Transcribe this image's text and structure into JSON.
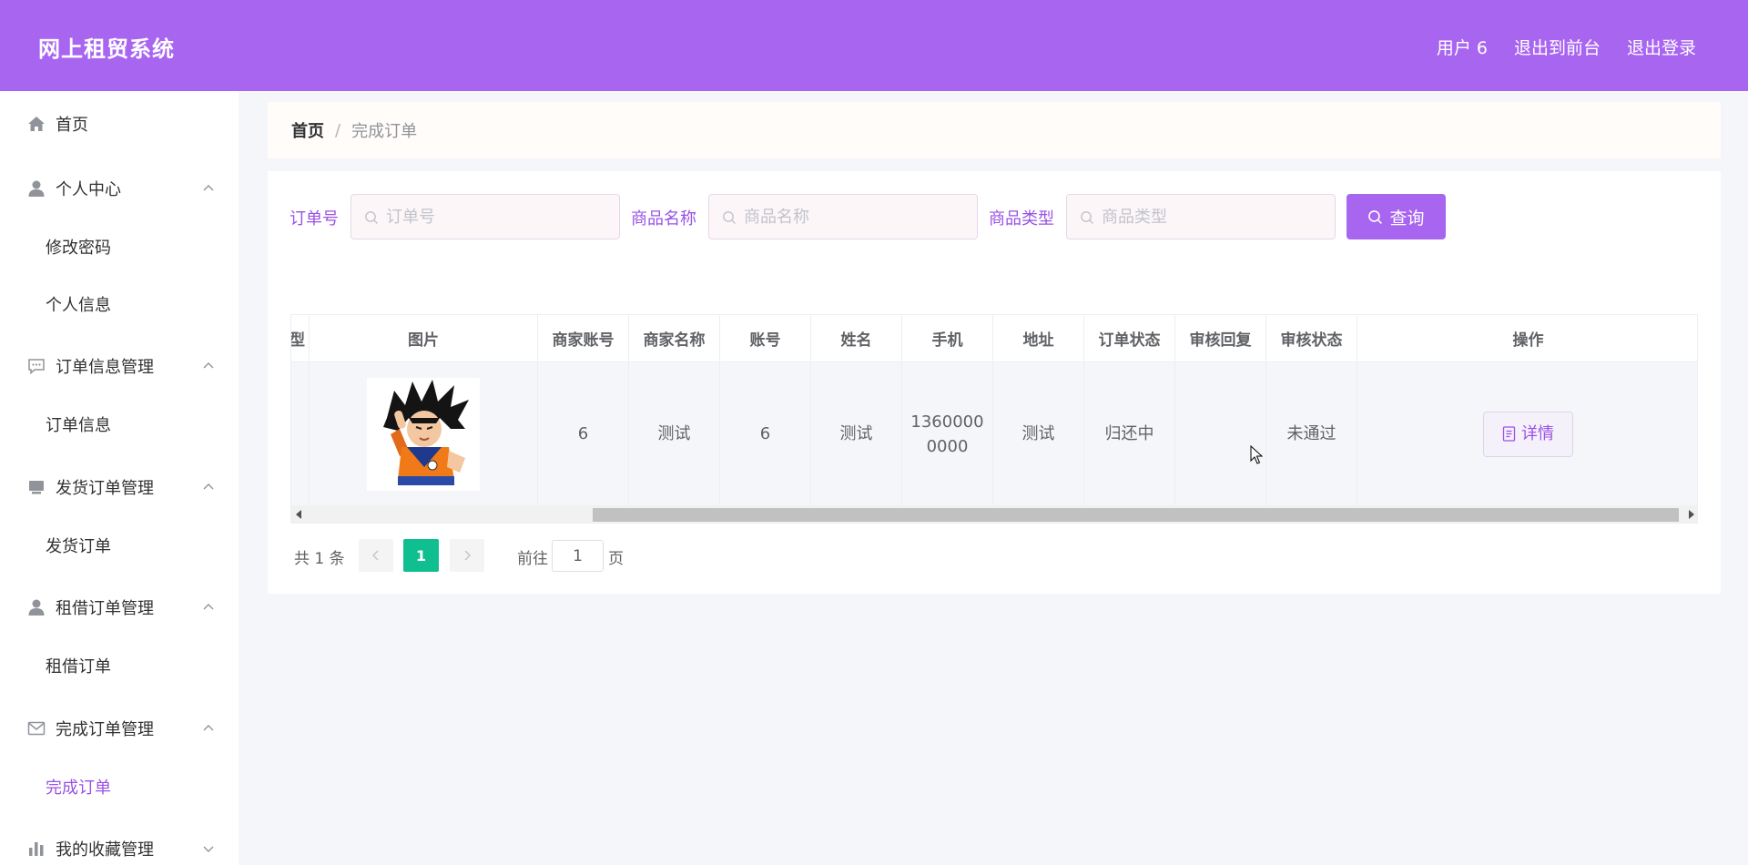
{
  "header": {
    "title": "网上租贸系统",
    "user": "用户 6",
    "exit_front": "退出到前台",
    "logout": "退出登录"
  },
  "sidebar": {
    "items": [
      {
        "label": "首页",
        "icon": "home-icon"
      },
      {
        "label": "个人中心",
        "icon": "user-icon",
        "children": [
          "修改密码",
          "个人信息"
        ]
      },
      {
        "label": "订单信息管理",
        "icon": "chat-icon",
        "children": [
          "订单信息"
        ]
      },
      {
        "label": "发货订单管理",
        "icon": "inbox-icon",
        "children": [
          "发货订单"
        ]
      },
      {
        "label": "租借订单管理",
        "icon": "user-icon",
        "children": [
          "租借订单"
        ]
      },
      {
        "label": "完成订单管理",
        "icon": "mail-icon",
        "children": [
          "完成订单"
        ]
      },
      {
        "label": "我的收藏管理",
        "icon": "chart-icon"
      }
    ],
    "active": "完成订单"
  },
  "breadcrumb": {
    "home": "首页",
    "separator": "/",
    "current": "完成订单"
  },
  "search": {
    "order_no_label": "订单号",
    "order_no_placeholder": "订单号",
    "product_name_label": "商品名称",
    "product_name_placeholder": "商品名称",
    "product_type_label": "商品类型",
    "product_type_placeholder": "商品类型",
    "query_button": "查询"
  },
  "table": {
    "columns": {
      "partial": "型",
      "image": "图片",
      "merchant_account": "商家账号",
      "merchant_name": "商家名称",
      "account": "账号",
      "name": "姓名",
      "phone": "手机",
      "address": "地址",
      "order_status": "订单状态",
      "review_reply": "审核回复",
      "review_status": "审核状态",
      "actions": "操作"
    },
    "rows": [
      {
        "merchant_account": "6",
        "merchant_name": "测试",
        "account": "6",
        "name": "测试",
        "phone": "13600000000",
        "address": "测试",
        "order_status": "归还中",
        "review_reply": "",
        "review_status": "未通过",
        "action": "详情"
      }
    ]
  },
  "pagination": {
    "total": "共 1 条",
    "current_page": "1",
    "goto_prefix": "前往",
    "goto_value": "1",
    "goto_suffix": "页"
  },
  "colors": {
    "primary": "#a865f0",
    "accent_text": "#9a52e6",
    "page_active": "#10bf90"
  }
}
